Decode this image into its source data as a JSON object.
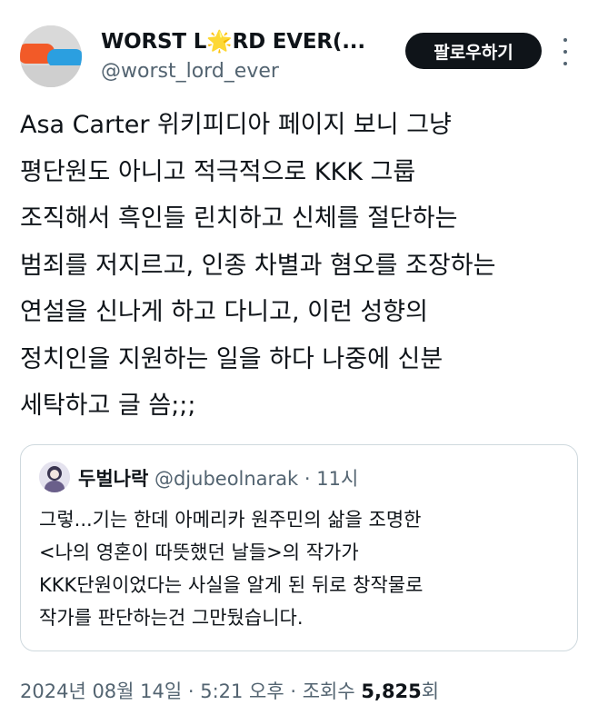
{
  "header": {
    "display_name": "WORST L🌟RD EVER(...",
    "handle": "@worst_lord_ever",
    "follow_label": "팔로우하기",
    "more_icon": "more-icon"
  },
  "tweet": {
    "lines": [
      "Asa Carter 위키피디아 페이지 보니 그냥",
      "평단원도 아니고 적극적으로 KKK 그룹",
      "조직해서 흑인들 린치하고 신체를 절단하는",
      "범죄를 저지르고, 인종 차별과 혐오를 조장하는",
      "연설을 신나게 하고 다니고, 이런 성향의",
      "정치인을 지원하는 일을 하다 나중에 신분",
      "세탁하고 글 씀;;;"
    ]
  },
  "quote": {
    "name": "두벌나락",
    "handle": "@djubeolnarak",
    "separator": "·",
    "time": "11시",
    "lines": [
      "그렇...기는 한데 아메리카 원주민의 삶을 조명한",
      "<나의 영혼이 따뜻했던 날들>의 작가가",
      "KKK단원이었다는 사실을 알게 된 뒤로 창작물로",
      "작가를 판단하는건 그만뒀습니다."
    ]
  },
  "footer": {
    "date_time": "2024년 08월 14일 · 5:21 오후 · 조회수 ",
    "views": "5,825",
    "views_suffix": "회"
  },
  "colors": {
    "text": "#0f1419",
    "secondary": "#536471",
    "border": "#cfd9de",
    "button_bg": "#0f1419"
  }
}
